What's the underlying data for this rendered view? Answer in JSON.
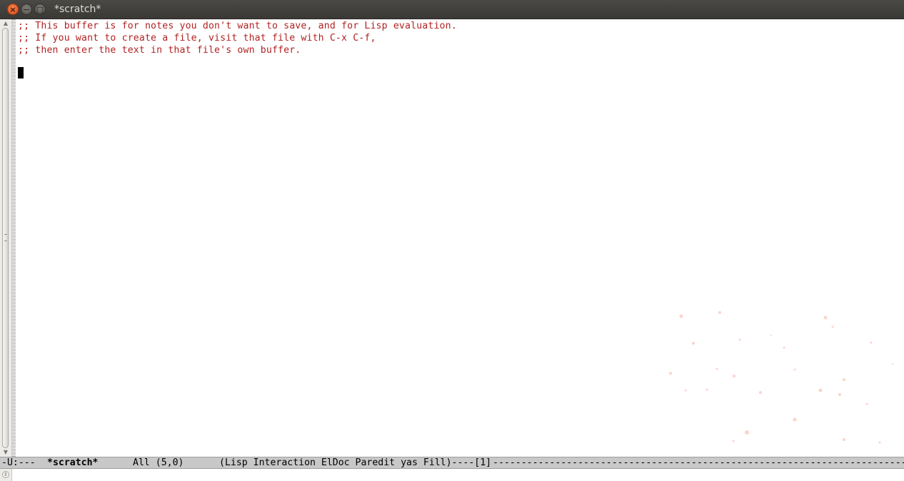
{
  "window": {
    "title": "*scratch*",
    "close_glyph": "×",
    "min_glyph": "−",
    "max_glyph": "□"
  },
  "buffer": {
    "lines": [
      ";; This buffer is for notes you don't want to save, and for Lisp evaluation.",
      ";; If you want to create a file, visit that file with C-x C-f,",
      ";; then enter the text in that file's own buffer."
    ]
  },
  "modeline": {
    "status": "-U:---",
    "buffer_name": "*scratch*",
    "position": "All (5,0)",
    "modes": "(Lisp Interaction ElDoc Paredit yas Fill)----[1]",
    "dashes": "--------------------------------------------------------------------------------------------"
  },
  "scrollbar": {
    "up_glyph": "▲",
    "down_glyph": "▼",
    "knob_glyph": "⇕"
  },
  "colors": {
    "comment": "#b22222",
    "titlebar": "#3c3b37",
    "modeline": "#c8c8c8"
  }
}
